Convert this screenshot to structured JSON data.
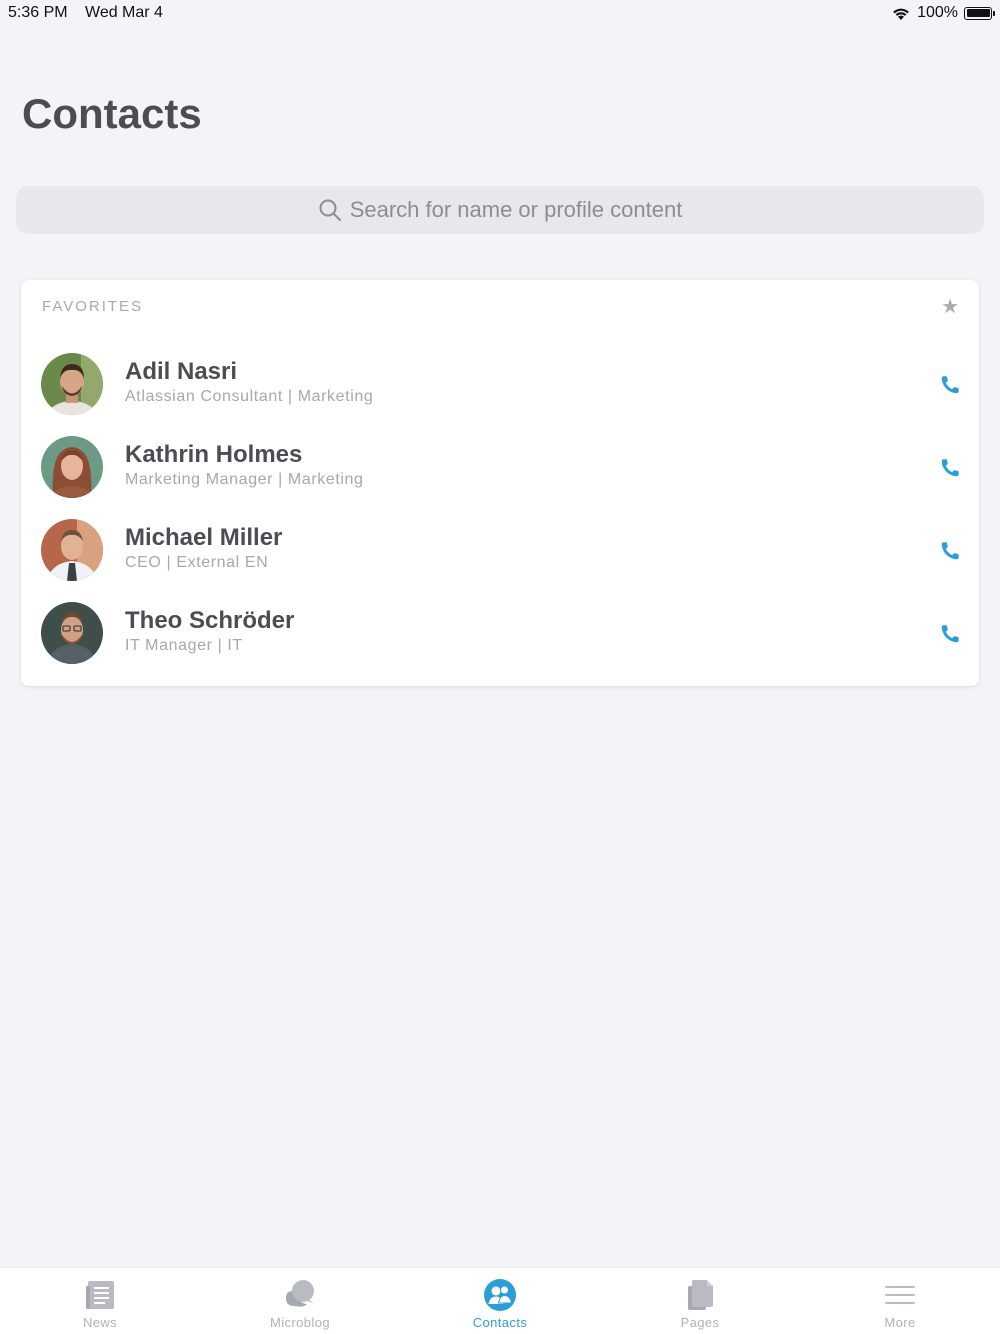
{
  "status_bar": {
    "time": "5:36 PM",
    "date": "Wed Mar 4",
    "battery": "100%"
  },
  "page": {
    "title": "Contacts"
  },
  "search": {
    "placeholder": "Search for name or profile content"
  },
  "favorites": {
    "header": "FAVORITES",
    "contacts": [
      {
        "name": "Adil Nasri",
        "subtitle": "Atlassian Consultant | Marketing"
      },
      {
        "name": "Kathrin Holmes",
        "subtitle": "Marketing Manager | Marketing"
      },
      {
        "name": "Michael Miller",
        "subtitle": "CEO | External EN"
      },
      {
        "name": "Theo Schröder",
        "subtitle": "IT Manager | IT"
      }
    ]
  },
  "tab_bar": {
    "tabs": [
      {
        "label": "News",
        "icon": "news-icon"
      },
      {
        "label": "Microblog",
        "icon": "microblog-icon"
      },
      {
        "label": "Contacts",
        "icon": "contacts-icon",
        "active": true
      },
      {
        "label": "Pages",
        "icon": "pages-icon"
      },
      {
        "label": "More",
        "icon": "more-icon"
      }
    ]
  },
  "colors": {
    "accent": "#2b9ed8",
    "background": "#f3f4f8"
  }
}
